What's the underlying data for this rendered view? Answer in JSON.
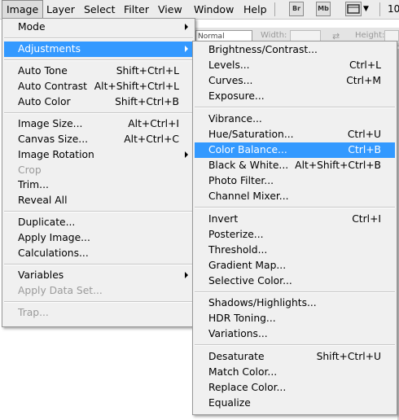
{
  "menubar": {
    "items": [
      "Image",
      "Layer",
      "Select",
      "Filter",
      "View",
      "Window",
      "Help"
    ],
    "active_item": "Image",
    "bridge_button": "Br",
    "minibridge_button": "Mb",
    "zoom_fragment": "10"
  },
  "options_bar": {
    "blend_value": "Normal",
    "width_label": "Width:",
    "height_label": "Height:"
  },
  "image_menu": {
    "groups": [
      [
        {
          "label": "Mode",
          "shortcut": "",
          "submenu": true,
          "disabled": false
        }
      ],
      [
        {
          "label": "Adjustments",
          "shortcut": "",
          "submenu": true,
          "disabled": false,
          "highlighted": true
        }
      ],
      [
        {
          "label": "Auto Tone",
          "shortcut": "Shift+Ctrl+L",
          "submenu": false,
          "disabled": false
        },
        {
          "label": "Auto Contrast",
          "shortcut": "Alt+Shift+Ctrl+L",
          "submenu": false,
          "disabled": false
        },
        {
          "label": "Auto Color",
          "shortcut": "Shift+Ctrl+B",
          "submenu": false,
          "disabled": false
        }
      ],
      [
        {
          "label": "Image Size...",
          "shortcut": "Alt+Ctrl+I",
          "submenu": false,
          "disabled": false
        },
        {
          "label": "Canvas Size...",
          "shortcut": "Alt+Ctrl+C",
          "submenu": false,
          "disabled": false
        },
        {
          "label": "Image Rotation",
          "shortcut": "",
          "submenu": true,
          "disabled": false
        },
        {
          "label": "Crop",
          "shortcut": "",
          "submenu": false,
          "disabled": true
        },
        {
          "label": "Trim...",
          "shortcut": "",
          "submenu": false,
          "disabled": false
        },
        {
          "label": "Reveal All",
          "shortcut": "",
          "submenu": false,
          "disabled": false
        }
      ],
      [
        {
          "label": "Duplicate...",
          "shortcut": "",
          "submenu": false,
          "disabled": false
        },
        {
          "label": "Apply Image...",
          "shortcut": "",
          "submenu": false,
          "disabled": false
        },
        {
          "label": "Calculations...",
          "shortcut": "",
          "submenu": false,
          "disabled": false
        }
      ],
      [
        {
          "label": "Variables",
          "shortcut": "",
          "submenu": true,
          "disabled": false
        },
        {
          "label": "Apply Data Set...",
          "shortcut": "",
          "submenu": false,
          "disabled": true
        }
      ],
      [
        {
          "label": "Trap...",
          "shortcut": "",
          "submenu": false,
          "disabled": true
        }
      ]
    ]
  },
  "adjustments_menu": {
    "groups": [
      [
        {
          "label": "Brightness/Contrast...",
          "shortcut": ""
        },
        {
          "label": "Levels...",
          "shortcut": "Ctrl+L"
        },
        {
          "label": "Curves...",
          "shortcut": "Ctrl+M"
        },
        {
          "label": "Exposure...",
          "shortcut": ""
        }
      ],
      [
        {
          "label": "Vibrance...",
          "shortcut": ""
        },
        {
          "label": "Hue/Saturation...",
          "shortcut": "Ctrl+U"
        },
        {
          "label": "Color Balance...",
          "shortcut": "Ctrl+B",
          "highlighted": true
        },
        {
          "label": "Black & White...",
          "shortcut": "Alt+Shift+Ctrl+B"
        },
        {
          "label": "Photo Filter...",
          "shortcut": ""
        },
        {
          "label": "Channel Mixer...",
          "shortcut": ""
        }
      ],
      [
        {
          "label": "Invert",
          "shortcut": "Ctrl+I"
        },
        {
          "label": "Posterize...",
          "shortcut": ""
        },
        {
          "label": "Threshold...",
          "shortcut": ""
        },
        {
          "label": "Gradient Map...",
          "shortcut": ""
        },
        {
          "label": "Selective Color...",
          "shortcut": ""
        }
      ],
      [
        {
          "label": "Shadows/Highlights...",
          "shortcut": ""
        },
        {
          "label": "HDR Toning...",
          "shortcut": ""
        },
        {
          "label": "Variations...",
          "shortcut": ""
        }
      ],
      [
        {
          "label": "Desaturate",
          "shortcut": "Shift+Ctrl+U"
        },
        {
          "label": "Match Color...",
          "shortcut": ""
        },
        {
          "label": "Replace Color...",
          "shortcut": ""
        },
        {
          "label": "Equalize",
          "shortcut": ""
        }
      ]
    ]
  },
  "colors": {
    "menu_bg": "#f0f0f0",
    "highlight": "#3399ff",
    "disabled_text": "#9a9a9a"
  }
}
